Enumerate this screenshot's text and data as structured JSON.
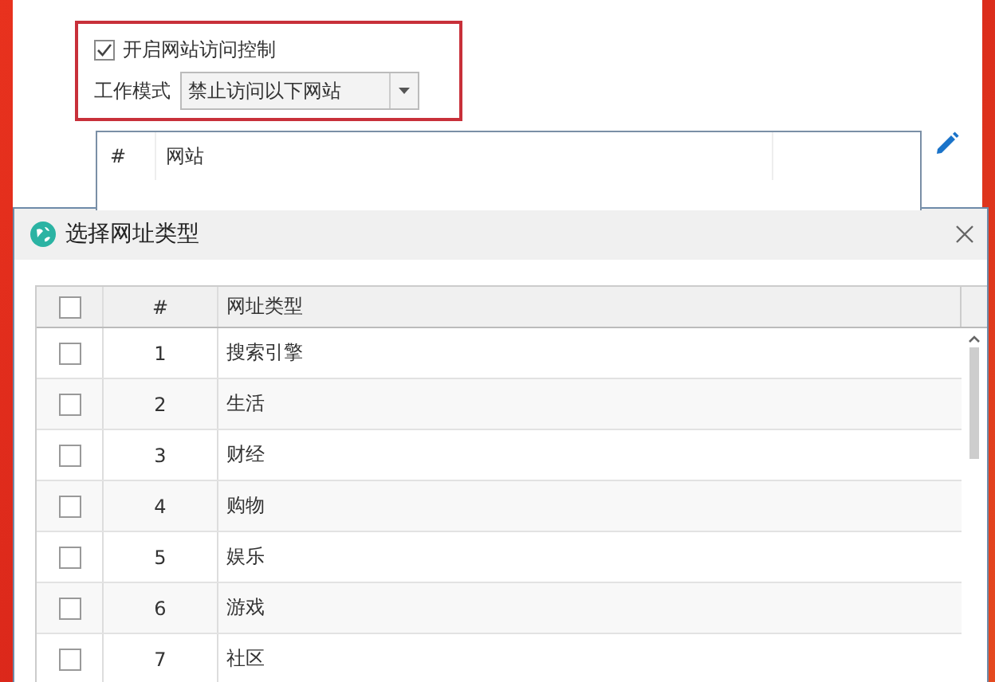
{
  "access_control": {
    "label": "开启网站访问控制",
    "checked": true
  },
  "work_mode": {
    "label": "工作模式",
    "value": "禁止访问以下网站"
  },
  "site_table": {
    "columns": [
      "#",
      "网站"
    ]
  },
  "dialog": {
    "title": "选择网址类型",
    "columns": [
      "#",
      "网址类型"
    ],
    "header_checked": false,
    "rows": [
      {
        "index": "1",
        "type": "搜索引擎",
        "checked": false
      },
      {
        "index": "2",
        "type": "生活",
        "checked": false
      },
      {
        "index": "3",
        "type": "财经",
        "checked": false
      },
      {
        "index": "4",
        "type": "购物",
        "checked": false
      },
      {
        "index": "5",
        "type": "娱乐",
        "checked": false
      },
      {
        "index": "6",
        "type": "游戏",
        "checked": false
      },
      {
        "index": "7",
        "type": "社区",
        "checked": false
      }
    ]
  }
}
